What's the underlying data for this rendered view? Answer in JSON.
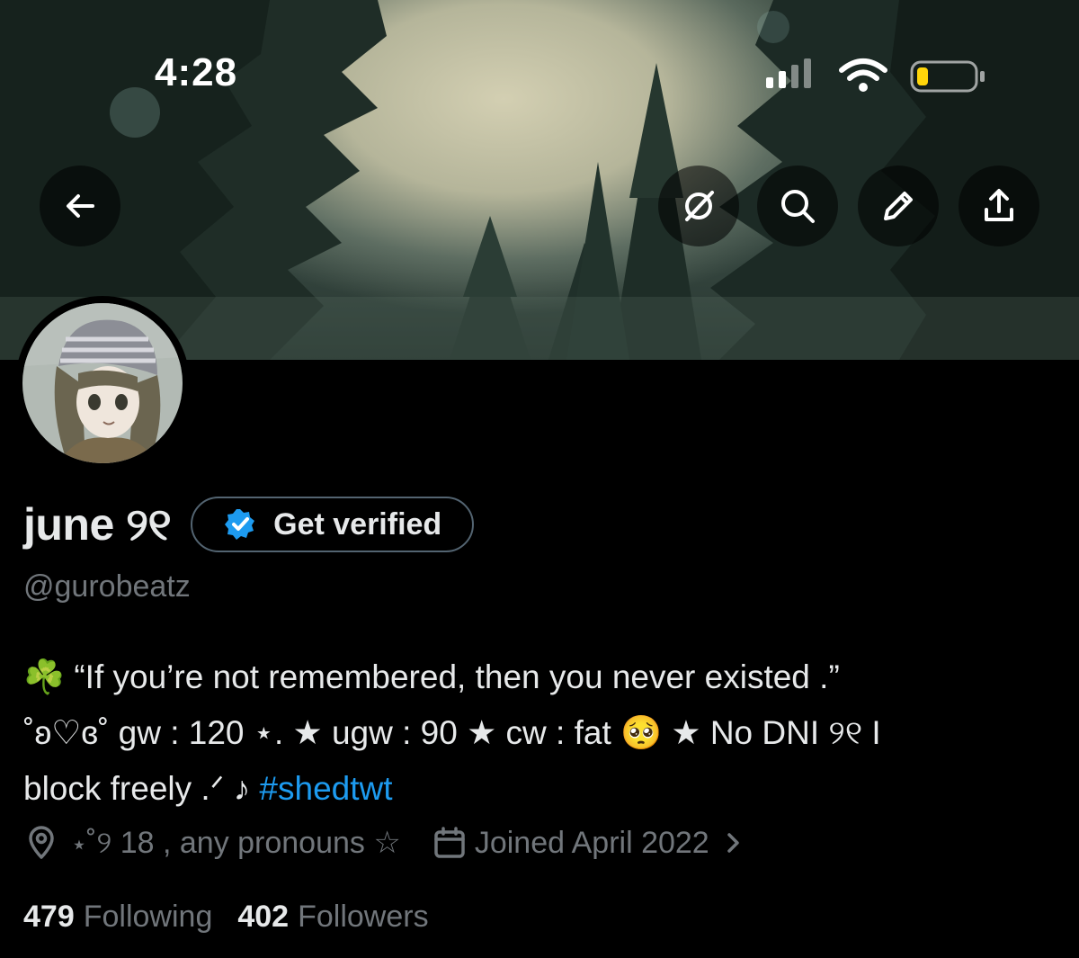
{
  "status_bar": {
    "time": "4:28",
    "icons": [
      "cellular-signal-icon",
      "wifi-icon",
      "battery-icon"
    ]
  },
  "header": {
    "buttons": [
      "back-arrow-icon",
      "grok-icon",
      "search-icon",
      "edit-pencil-icon",
      "share-icon"
    ]
  },
  "profile": {
    "display_name": "june ୨୧",
    "verify_label": "Get verified",
    "handle": "@gurobeatz",
    "bio_line1": "☘️ “If you’re not remembered, then you never existed .”",
    "bio_line2": "˚ʚ♡ɞ˚ gw : 120 ⋆. ★ ugw : 90 ★ cw : fat 🥺 ★ No DNI ୨୧ I",
    "bio_line3": "block freely .ᐟ ♪ ",
    "bio_hashtag": "#shedtwt",
    "location": "⋆˚୨ 18 , any pronouns ☆",
    "joined": "Joined April 2022",
    "following_count": "479",
    "following_label": "Following",
    "followers_count": "402",
    "followers_label": "Followers"
  },
  "colors": {
    "background": "#000000",
    "primary_text": "#e7e9ea",
    "secondary_text": "#71767b",
    "link": "#1d9bf0",
    "verified_badge": "#1d9bf0"
  }
}
